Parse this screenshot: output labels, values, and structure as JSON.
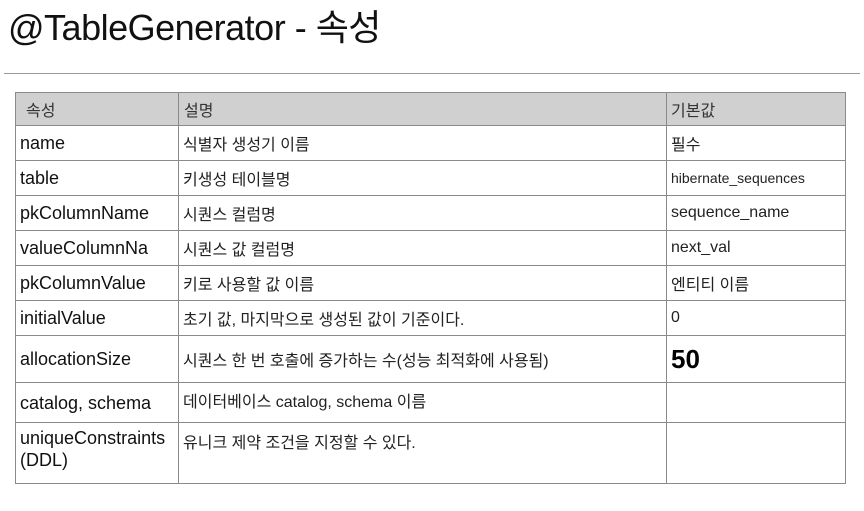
{
  "title": "@TableGenerator - 속성",
  "table": {
    "headers": {
      "name": "속성",
      "description": "설명",
      "default": "기본값"
    },
    "rows": [
      {
        "name": "name",
        "description": "식별자 생성기 이름",
        "default": "필수"
      },
      {
        "name": "table",
        "description": "키생성 테이블명",
        "default": "hibernate_sequences"
      },
      {
        "name": "pkColumnName",
        "description": "시퀀스 컬럼명",
        "default": "sequence_name"
      },
      {
        "name": "valueColumnNa",
        "description": "시퀀스 값 컬럼명",
        "default": "next_val"
      },
      {
        "name": "pkColumnValue",
        "description": "키로 사용할 값 이름",
        "default": "엔티티 이름"
      },
      {
        "name": "initialValue",
        "description": "초기 값, 마지막으로 생성된 값이 기준이다.",
        "default": "0"
      },
      {
        "name": "allocationSize",
        "description": "시퀀스 한 번 호출에 증가하는 수(성능 최적화에 사용됨)",
        "default": "50"
      },
      {
        "name": "catalog, schema",
        "description": "데이터베이스 catalog, schema 이름",
        "default": ""
      },
      {
        "name": "uniqueConstraints(DDL)",
        "description": "유니크 제약 조건을 지정할 수 있다.",
        "default": ""
      }
    ]
  }
}
